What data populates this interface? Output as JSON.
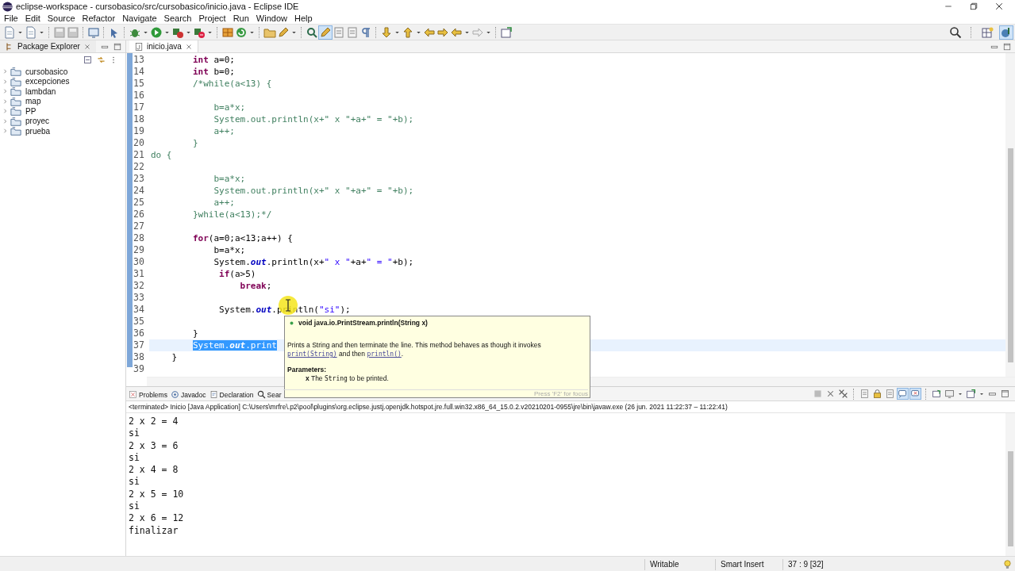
{
  "window": {
    "title": "eclipse-workspace - cursobasico/src/cursobasico/inicio.java - Eclipse IDE"
  },
  "menu": [
    "File",
    "Edit",
    "Source",
    "Refactor",
    "Navigate",
    "Search",
    "Project",
    "Run",
    "Window",
    "Help"
  ],
  "package_explorer": {
    "title": "Package Explorer",
    "items": [
      {
        "label": "cursobasico",
        "expanded": false
      },
      {
        "label": "excepciones",
        "expanded": false
      },
      {
        "label": "lambdan",
        "expanded": false
      },
      {
        "label": "map",
        "expanded": false
      },
      {
        "label": "PP",
        "expanded": false
      },
      {
        "label": "proyec",
        "expanded": false
      },
      {
        "label": "prueba",
        "expanded": false
      }
    ]
  },
  "editor": {
    "tab": "inicio.java",
    "lines": [
      {
        "number": "13",
        "segments": [
          {
            "text": "        int",
            "kind": "keyword"
          },
          {
            "text": " a=0;",
            "kind": "plain"
          }
        ]
      },
      {
        "number": "14",
        "segments": [
          {
            "text": "        int",
            "kind": "keyword"
          },
          {
            "text": " b=0;",
            "kind": "plain"
          }
        ]
      },
      {
        "number": "15",
        "segments": [
          {
            "text": "        /*while(a<13) {",
            "kind": "comment"
          }
        ]
      },
      {
        "number": "16"
      },
      {
        "number": "17",
        "segments": [
          {
            "text": "            b=a*x;",
            "kind": "comment"
          }
        ]
      },
      {
        "number": "18",
        "segments": [
          {
            "text": "            System.out.println(x+\" x \"+a+\" = \"+b);",
            "kind": "comment"
          }
        ]
      },
      {
        "number": "19",
        "segments": [
          {
            "text": "            a++;",
            "kind": "comment"
          }
        ]
      },
      {
        "number": "20",
        "segments": [
          {
            "text": "        }",
            "kind": "comment"
          }
        ]
      },
      {
        "number": "21",
        "segments": [
          {
            "text": "do {",
            "kind": "comment"
          }
        ]
      },
      {
        "number": "22"
      },
      {
        "number": "23",
        "segments": [
          {
            "text": "            b=a*x;",
            "kind": "comment"
          }
        ]
      },
      {
        "number": "24",
        "segments": [
          {
            "text": "            System.out.println(x+\" x \"+a+\" = \"+b);",
            "kind": "comment"
          }
        ]
      },
      {
        "number": "25",
        "segments": [
          {
            "text": "            a++;",
            "kind": "comment"
          }
        ]
      },
      {
        "number": "26",
        "segments": [
          {
            "text": "        }while(a<13);*/",
            "kind": "comment"
          }
        ]
      },
      {
        "number": "27"
      },
      {
        "number": "28",
        "segments": [
          {
            "text": "        for",
            "kind": "keyword"
          },
          {
            "text": "(a=0;a<13;a++) {",
            "kind": "plain"
          }
        ]
      },
      {
        "number": "29",
        "segments": [
          {
            "text": "            b=a*x;",
            "kind": "plain"
          }
        ]
      },
      {
        "number": "30",
        "segments": [
          {
            "text": "            System.",
            "kind": "plain"
          },
          {
            "text": "out",
            "kind": "field"
          },
          {
            "text": ".println(x+",
            "kind": "plain"
          },
          {
            "text": "\" x \"",
            "kind": "string"
          },
          {
            "text": "+a+",
            "kind": "plain"
          },
          {
            "text": "\" = \"",
            "kind": "string"
          },
          {
            "text": "+b);",
            "kind": "plain"
          }
        ]
      },
      {
        "number": "31",
        "segments": [
          {
            "text": "             if",
            "kind": "keyword"
          },
          {
            "text": "(a>5)",
            "kind": "plain"
          }
        ]
      },
      {
        "number": "32",
        "segments": [
          {
            "text": "                 break",
            "kind": "keyword"
          },
          {
            "text": ";",
            "kind": "plain"
          }
        ]
      },
      {
        "number": "33"
      },
      {
        "number": "34",
        "segments": [
          {
            "text": "             System.",
            "kind": "plain"
          },
          {
            "text": "out",
            "kind": "field"
          },
          {
            "text": ".println(",
            "kind": "plain"
          },
          {
            "text": "\"si\"",
            "kind": "string"
          },
          {
            "text": ");",
            "kind": "plain"
          }
        ]
      },
      {
        "number": "35"
      },
      {
        "number": "36",
        "segments": [
          {
            "text": "        }",
            "kind": "plain"
          }
        ]
      },
      {
        "number": "37",
        "current": true,
        "segments": [
          {
            "text": "        System.",
            "kind": "plain",
            "selected": true
          },
          {
            "text": "out",
            "kind": "field",
            "selected": true
          },
          {
            "text": ".print",
            "kind": "plain",
            "selected": true
          }
        ]
      },
      {
        "number": "38",
        "segments": [
          {
            "text": "    }",
            "kind": "plain"
          }
        ]
      },
      {
        "number": "39"
      }
    ]
  },
  "hover": {
    "signature": "void java.io.PrintStream.println(String x)",
    "description": [
      {
        "text": "Prints a String and then terminate the line. This method behaves as though it invokes ",
        "kind": "plain"
      },
      {
        "text": "print(String)",
        "kind": "link"
      },
      {
        "text": " and then ",
        "kind": "plain"
      },
      {
        "text": "println()",
        "kind": "link"
      },
      {
        "text": ".",
        "kind": "plain"
      }
    ],
    "parameters_label": "Parameters:",
    "parameter": [
      {
        "text": "x",
        "kind": "bold"
      },
      {
        "text": " The ",
        "kind": "plain"
      },
      {
        "text": "String",
        "kind": "code"
      },
      {
        "text": " to be printed.",
        "kind": "plain"
      }
    ],
    "footer": "Press 'F2' for focus"
  },
  "bottom_panel": {
    "tabs": [
      {
        "label": "Problems",
        "selected": false
      },
      {
        "label": "Javadoc",
        "selected": false
      },
      {
        "label": "Declaration",
        "selected": false
      },
      {
        "label": "Sear",
        "selected": false
      }
    ],
    "header": "<terminated> Inicio [Java Application] C:\\Users\\mrfre\\.p2\\pool\\plugins\\org.eclipse.justj.openjdk.hotspot.jre.full.win32.x86_64_15.0.2.v20210201-0955\\jre\\bin\\javaw.exe  (26 jun. 2021 11:22:37 – 11:22:41)",
    "output": [
      "2 x 2 = 4",
      "si",
      "2 x 3 = 6",
      "si",
      "2 x 4 = 8",
      "si",
      "2 x 5 = 10",
      "si",
      "2 x 6 = 12",
      "finalizar"
    ]
  },
  "status_bar": {
    "mode": "Writable",
    "insert": "Smart Insert",
    "position": "37 : 9 [32]"
  }
}
